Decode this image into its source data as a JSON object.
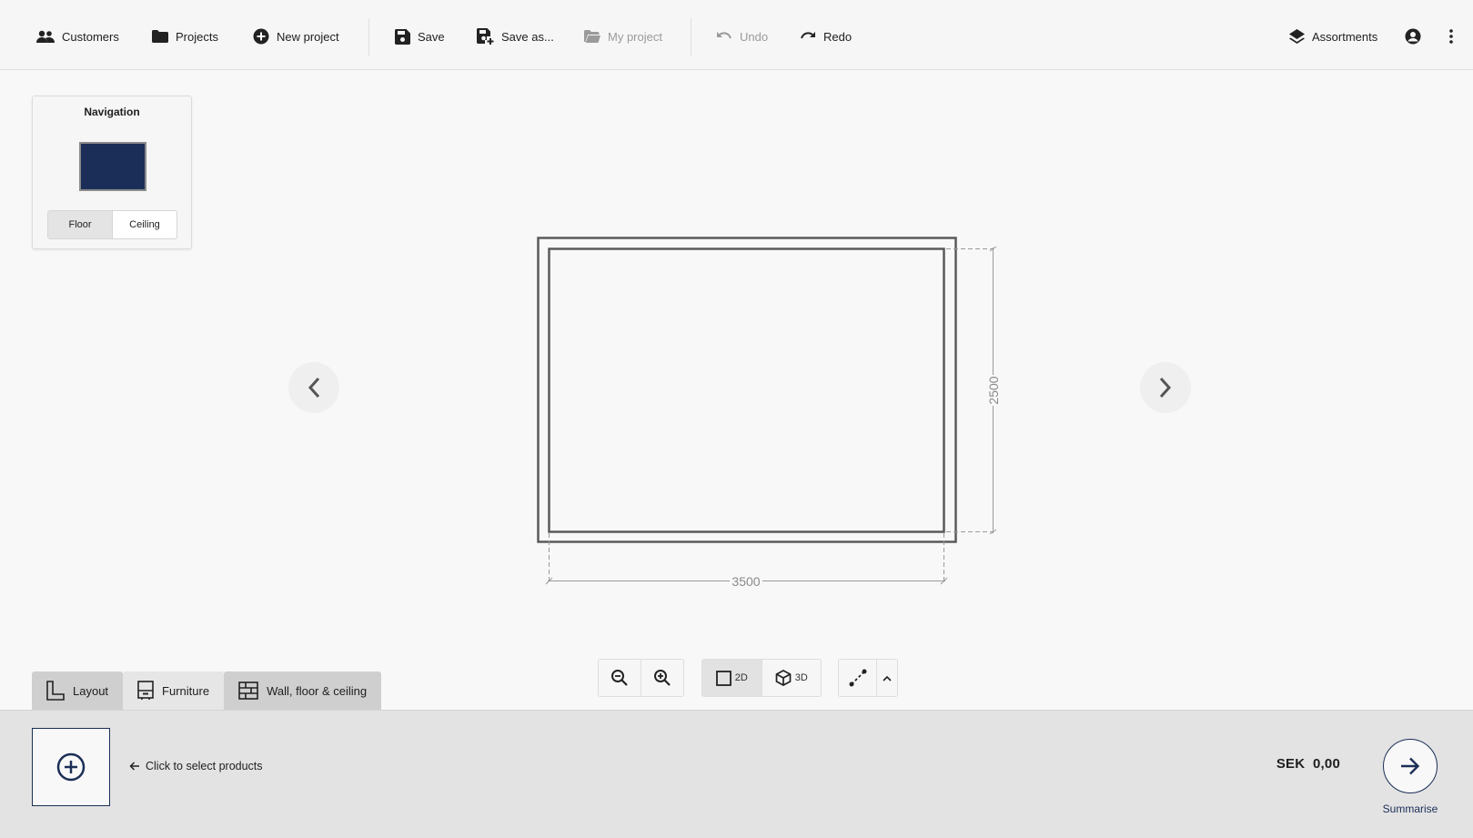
{
  "toolbar": {
    "customers_label": "Customers",
    "projects_label": "Projects",
    "new_project_label": "New project",
    "save_label": "Save",
    "save_as_label": "Save as...",
    "my_project_label": "My project",
    "undo_label": "Undo",
    "redo_label": "Redo",
    "assortments_label": "Assortments"
  },
  "navigation": {
    "title": "Navigation",
    "thumbnail_color": "#1b2e57",
    "floor_label": "Floor",
    "ceiling_label": "Ceiling",
    "selected": "Floor"
  },
  "plan": {
    "width_dimension": "3500",
    "height_dimension": "2500"
  },
  "view_controls": {
    "view_2d_label": "2D",
    "view_3d_label": "3D",
    "selected_view": "2D"
  },
  "tabs": [
    {
      "label": "Layout",
      "icon": "layout-icon"
    },
    {
      "label": "Furniture",
      "icon": "furniture-icon"
    },
    {
      "label": "Wall, floor & ceiling",
      "icon": "wall-icon"
    }
  ],
  "bottom": {
    "hint": "Click to select products",
    "price": "SEK  0,00",
    "summarise_label": "Summarise"
  },
  "colors": {
    "accent": "#1b2e57",
    "disabled": "#9a9a9a"
  }
}
